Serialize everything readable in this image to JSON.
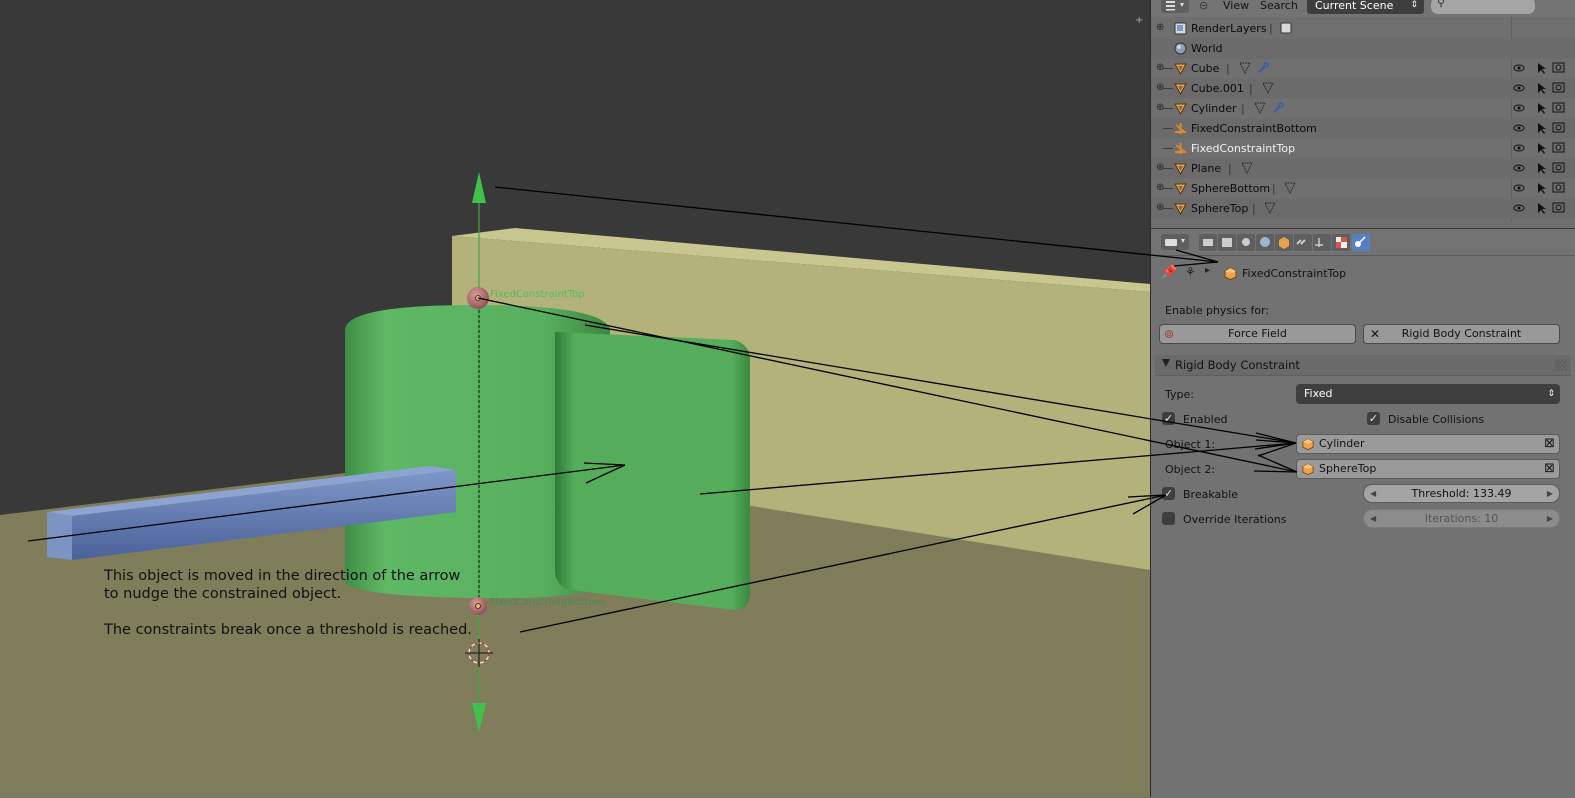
{
  "viewport": {
    "label_top": "FixedConstraintTop",
    "label_bottom": "FixedConstraintBottom",
    "annotation_line1": "This object is moved in the direction of the arrow",
    "annotation_line2": "to nudge the constrained object.",
    "annotation_line3": "The constraints break once a threshold is reached."
  },
  "outliner": {
    "menu_view": "View",
    "menu_search": "Search",
    "scene_selector": "Current Scene",
    "rows": [
      {
        "label": "RenderLayers",
        "icon": "renderlayers-icon"
      },
      {
        "label": "World",
        "icon": "world-icon"
      },
      {
        "label": "Cube",
        "icon": "mesh-object-icon"
      },
      {
        "label": "Cube.001",
        "icon": "mesh-object-icon"
      },
      {
        "label": "Cylinder",
        "icon": "mesh-object-icon"
      },
      {
        "label": "FixedConstraintBottom",
        "icon": "empty-object-icon"
      },
      {
        "label": "FixedConstraintTop",
        "icon": "empty-object-icon"
      },
      {
        "label": "Plane",
        "icon": "mesh-object-icon"
      },
      {
        "label": "SphereBottom",
        "icon": "mesh-object-icon"
      },
      {
        "label": "SphereTop",
        "icon": "mesh-object-icon"
      }
    ]
  },
  "properties": {
    "context_object": "FixedConstraintTop",
    "enable_physics_label": "Enable physics for:",
    "force_field_button": "Force Field",
    "rbc_button": "Rigid Body Constraint",
    "panel_title": "Rigid Body Constraint",
    "type_label": "Type:",
    "type_value": "Fixed",
    "enabled_label": "Enabled",
    "disable_collisions_label": "Disable Collisions",
    "object1_label": "Object 1:",
    "object1_value": "Cylinder",
    "object2_label": "Object 2:",
    "object2_value": "SphereTop",
    "breakable_label": "Breakable",
    "threshold_value": "Threshold: 133.49",
    "override_iterations_label": "Override Iterations",
    "iterations_value": "Iterations: 10",
    "checkbox_mark": "✓"
  },
  "colors": {
    "viewport_bg": "#393939",
    "floor": "#7f7d5a",
    "wall": "#b3b27a",
    "cylinder_green": "#58b25e",
    "bar_blue": "#5a76b0",
    "active_tab": "#5680c2"
  }
}
